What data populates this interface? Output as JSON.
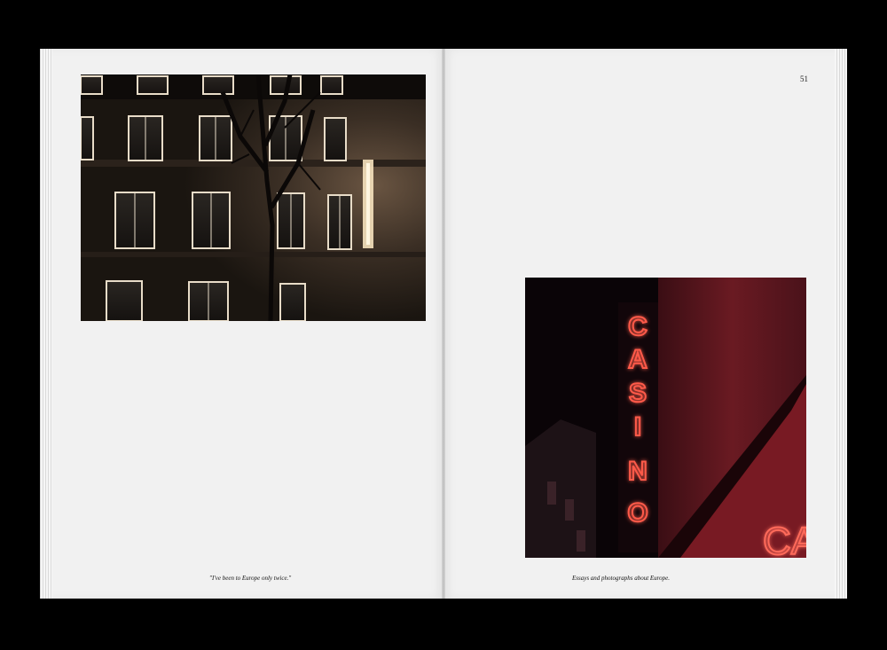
{
  "spread": {
    "page_number": "51",
    "left_caption": "\"I've been to Europe only twice.\"",
    "right_caption": "Essays and photographs about Europe.",
    "sign_text": "CASINO",
    "sign_letters": [
      "C",
      "A",
      "S",
      "I",
      "N",
      "O"
    ],
    "partial_sign_text": "CA"
  }
}
